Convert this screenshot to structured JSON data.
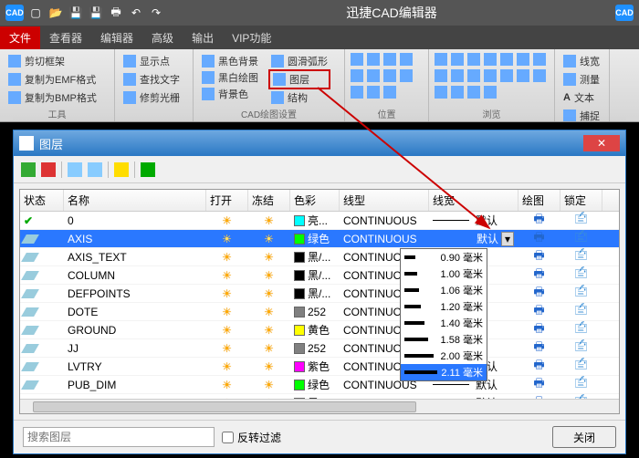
{
  "app": {
    "title": "迅捷CAD编辑器",
    "badge": "CAD"
  },
  "tabs": [
    "文件",
    "查看器",
    "编辑器",
    "高级",
    "输出",
    "VIP功能"
  ],
  "ribbon": {
    "g1": [
      "剪切框架",
      "复制为EMF格式",
      "复制为BMP格式"
    ],
    "g1_label": "工具",
    "g2": [
      "显示点",
      "查找文字",
      "修剪光栅"
    ],
    "g3": [
      "黑色背景",
      "黑白绘图",
      "背景色"
    ],
    "g3_label": "CAD绘图设置",
    "g4": [
      "圆滑弧形",
      "图层",
      "结构"
    ],
    "g5_label": "位置",
    "g6_label": "浏览",
    "g7": [
      "线宽",
      "测量",
      "文本",
      "捕捉"
    ]
  },
  "dialog": {
    "title": "图层",
    "columns": [
      "状态",
      "名称",
      "打开",
      "冻结",
      "色彩",
      "线型",
      "线宽",
      "绘图",
      "锁定"
    ],
    "rows": [
      {
        "state": "cur",
        "name": "0",
        "color": "#00ffff",
        "colorName": "亮...",
        "ltype": "CONTINUOUS",
        "lw": "默认"
      },
      {
        "state": "sel",
        "name": "AXIS",
        "color": "#00ff00",
        "colorName": "绿色",
        "ltype": "CONTINUOUS",
        "lw": "默认"
      },
      {
        "state": "",
        "name": "AXIS_TEXT",
        "color": "#000000",
        "colorName": "黑/...",
        "ltype": "CONTINUOUS",
        "lw": ""
      },
      {
        "state": "",
        "name": "COLUMN",
        "color": "#000000",
        "colorName": "黑/...",
        "ltype": "CONTINUOUS",
        "lw": ""
      },
      {
        "state": "",
        "name": "DEFPOINTS",
        "color": "#000000",
        "colorName": "黑/...",
        "ltype": "CONTINUOUS",
        "lw": ""
      },
      {
        "state": "",
        "name": "DOTE",
        "color": "#808080",
        "colorName": "252",
        "ltype": "CONTINUOUS",
        "lw": ""
      },
      {
        "state": "",
        "name": "GROUND",
        "color": "#ffff00",
        "colorName": "黄色",
        "ltype": "CONTINUOUS",
        "lw": ""
      },
      {
        "state": "",
        "name": "JJ",
        "color": "#808080",
        "colorName": "252",
        "ltype": "CONTINUOUS",
        "lw": ""
      },
      {
        "state": "",
        "name": "LVTRY",
        "color": "#ff00ff",
        "colorName": "紫色",
        "ltype": "CONTINUOUS",
        "lw": "默认"
      },
      {
        "state": "",
        "name": "PUB_DIM",
        "color": "#00ff00",
        "colorName": "绿色",
        "ltype": "CONTINUOUS",
        "lw": "默认"
      },
      {
        "state": "",
        "name": "PUB_TEXT",
        "color": "#000000",
        "colorName": "黑/...",
        "ltype": "CONTINUOUS",
        "lw": "默认"
      }
    ],
    "lw_options": [
      "0.90 毫米",
      "1.00 毫米",
      "1.06 毫米",
      "1.20 毫米",
      "1.40 毫米",
      "1.58 毫米",
      "2.00 毫米",
      "2.11 毫米"
    ],
    "lw_selected": "默认",
    "search_placeholder": "搜索图层",
    "reverse_filter": "反转过滤",
    "close": "关闭"
  }
}
